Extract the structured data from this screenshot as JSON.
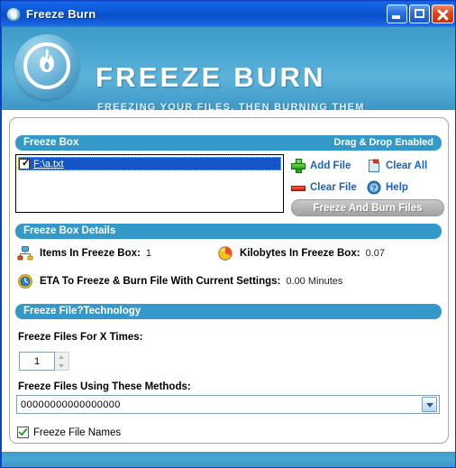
{
  "window": {
    "title": "Freeze Burn",
    "icon": "app-flame-icon",
    "buttons": {
      "minimize": "Minimize",
      "maximize": "Maximize",
      "close": "Close"
    }
  },
  "banner": {
    "logo": "flame-circle-logo",
    "title": "FREEZE BURN",
    "subtitle": "FREEZING YOUR FILES. THEN BURNING THEM"
  },
  "freeze_box": {
    "section_title": "Freeze Box",
    "section_note": "Drag & Drop Enabled",
    "items": [
      {
        "label": "F:\\a.txt",
        "checked": true,
        "selected": true
      }
    ],
    "actions": [
      {
        "label": "Add File",
        "icon": "plus-icon"
      },
      {
        "label": "Clear All",
        "icon": "clear-all-page-icon"
      },
      {
        "label": "Clear File",
        "icon": "minus-icon"
      },
      {
        "label": "Help",
        "icon": "help-question-icon"
      }
    ],
    "primary_button": "Freeze And Burn Files"
  },
  "details": {
    "section_title": "Freeze Box Details",
    "rows": [
      {
        "icon": "network-nodes-icon",
        "label": "Items In Freeze Box:",
        "value": "1"
      },
      {
        "icon": "pie-sphere-icon",
        "label": "Kilobytes In Freeze Box:",
        "value": "0.07"
      },
      {
        "icon": "clock-icon",
        "label": "ETA To Freeze & Burn File With Current Settings:",
        "value": "0.00 Minutes"
      }
    ]
  },
  "technology": {
    "section_title": "Freeze File?Technology",
    "times_label": "Freeze Files For X Times:",
    "times_value": "1",
    "methods_label": "Freeze Files Using These Methods:",
    "methods_value": "00000000000000000",
    "freeze_names_label": "Freeze File Names",
    "freeze_names_checked": true
  },
  "colors": {
    "titlebar_blue": "#0a55d4",
    "banner_blue": "#4aa7d2",
    "section_blue": "#3498c8",
    "link_blue": "#1a62c0",
    "selection_blue": "#1456c8"
  }
}
